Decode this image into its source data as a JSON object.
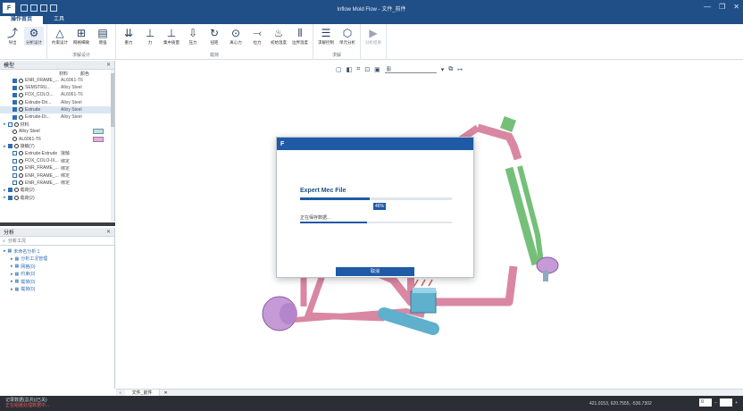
{
  "app": {
    "title": "Inflow Mold Flow - 文件_前件",
    "logo": "F"
  },
  "tabs": [
    {
      "label": "操作首页"
    },
    {
      "label": "工具"
    }
  ],
  "ribbon": {
    "groups": [
      {
        "label": "",
        "buttons": [
          {
            "label": "导出",
            "icon": "export-icon"
          },
          {
            "label": "分析设计",
            "icon": "analysis-icon"
          }
        ]
      },
      {
        "label": "求解设计",
        "buttons": [
          {
            "label": "约束设计",
            "icon": "constraint-icon"
          },
          {
            "label": "网格细微",
            "icon": "mesh-icon"
          },
          {
            "label": "增强",
            "icon": "reinforce-icon"
          }
        ]
      },
      {
        "label": "载荷",
        "buttons": [
          {
            "label": "重力",
            "icon": "gravity-icon"
          },
          {
            "label": "力",
            "icon": "force-icon"
          },
          {
            "label": "集中质量",
            "icon": "mass-icon"
          },
          {
            "label": "压力",
            "icon": "pressure-icon"
          },
          {
            "label": "扭矩",
            "icon": "torque-icon"
          },
          {
            "label": "离心力",
            "icon": "centrifugal-icon"
          },
          {
            "label": "拉力",
            "icon": "pull-icon"
          },
          {
            "label": "初始温度",
            "icon": "temperature-icon"
          },
          {
            "label": "边界温度",
            "icon": "boundary-temp-icon"
          }
        ]
      },
      {
        "label": "求解",
        "buttons": [
          {
            "label": "求解控制",
            "icon": "solve-control-icon"
          },
          {
            "label": "单元分析",
            "icon": "element-icon"
          }
        ]
      },
      {
        "label": "",
        "buttons": [
          {
            "label": "分析结果",
            "icon": "result-icon"
          }
        ]
      }
    ]
  },
  "left_panel": {
    "title": "模型",
    "columns": [
      "材料",
      "颜色"
    ],
    "rows": [
      {
        "name": "ENR_FRAME_...",
        "material": "AL6061-T6",
        "indent": 1,
        "checked": true,
        "selected": false
      },
      {
        "name": "SEMSTRU...",
        "material": "Alloy Steel",
        "indent": 1,
        "checked": true,
        "selected": false
      },
      {
        "name": "FOX_COLO...",
        "material": "AL6061-T6",
        "indent": 1,
        "checked": true,
        "selected": false
      },
      {
        "name": "Extrude-Dri...",
        "material": "Alloy Steel",
        "indent": 1,
        "checked": true,
        "selected": false
      },
      {
        "name": "Extrude",
        "material": "Alloy Steel",
        "indent": 1,
        "checked": true,
        "selected": true
      },
      {
        "name": "Extrude-Di...",
        "material": "Alloy Steel",
        "indent": 1,
        "checked": true,
        "selected": false
      },
      {
        "name": "材料",
        "material": "",
        "indent": 0,
        "checked": false,
        "selected": false,
        "group": true
      },
      {
        "name": "Alloy Steel",
        "material": "",
        "indent": 1,
        "swatch": "#aee7f0",
        "selected": false
      },
      {
        "name": "AL6061-T6",
        "material": "",
        "indent": 1,
        "swatch": "#f0a7e8",
        "selected": false
      },
      {
        "name": "接触(7)",
        "material": "",
        "indent": 0,
        "checked": true,
        "selected": false,
        "group": true
      },
      {
        "name": "Extrude-Extrude",
        "material": "接触",
        "indent": 1,
        "checked": false,
        "selected": false
      },
      {
        "name": "FOX_COLO-IX...",
        "material": "绑定",
        "indent": 1,
        "checked": false,
        "selected": false
      },
      {
        "name": "ENR_FRAME_...",
        "material": "绑定",
        "indent": 1,
        "checked": false,
        "selected": false
      },
      {
        "name": "ENR_FRAME_...",
        "material": "绑定",
        "indent": 1,
        "checked": false,
        "selected": false
      },
      {
        "name": "ENR_FRAME_...",
        "material": "绑定",
        "indent": 1,
        "checked": false,
        "selected": false
      },
      {
        "name": "载荷(2)",
        "material": "",
        "indent": 0,
        "checked": true,
        "selected": false,
        "group": true
      },
      {
        "name": "载荷(2)",
        "material": "",
        "indent": 0,
        "checked": true,
        "selected": false,
        "group": true
      }
    ]
  },
  "analysis_panel": {
    "title": "分析",
    "search_placeholder": "分析工况",
    "rows": [
      {
        "name": "未命名分析 1",
        "indent": 0
      },
      {
        "name": "分析工况管理",
        "indent": 1
      },
      {
        "name": "网格(0)",
        "indent": 1
      },
      {
        "name": "约束(0)",
        "indent": 1
      },
      {
        "name": "载荷(0)",
        "indent": 1
      },
      {
        "name": "载荷(0)",
        "indent": 1
      }
    ]
  },
  "viewport": {
    "dropdown_value": "图"
  },
  "dialog": {
    "logo": "F",
    "title": "Expert Mec File",
    "progress": 0.46,
    "progress_label": "46%",
    "subtitle": "正在保存数据...",
    "subprogress": 0.44,
    "cancel_label": "取消"
  },
  "bottom_tab": {
    "label": "文件_前件"
  },
  "status": {
    "line1": "记录数据(总共)(已关)",
    "line2": "正在组装处理数据中...",
    "coords": "421.0153, 620.7555, -530.7302",
    "zoom_value": "0"
  },
  "colors": {
    "frame": "#d987a2",
    "fork": "#75c079",
    "stem": "#5fb0cc",
    "hub": "#c59ad6",
    "brand": "#1f4f86"
  }
}
